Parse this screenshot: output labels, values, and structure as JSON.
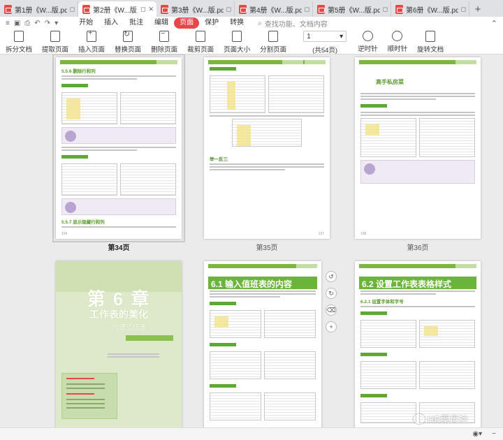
{
  "tabs": [
    {
      "label": "第1册《W...版.pdf",
      "active": false
    },
    {
      "label": "第2册《W...版.pdf",
      "active": true
    },
    {
      "label": "第3册《W...版.pdf",
      "active": false
    },
    {
      "label": "第4册《W...版.pdf",
      "active": false
    },
    {
      "label": "第5册《W...版.pdf",
      "active": false
    },
    {
      "label": "第6册《W...版.pdf",
      "active": false
    }
  ],
  "menu": {
    "items": [
      "开始",
      "插入",
      "批注",
      "编辑",
      "页面",
      "保护",
      "转换"
    ],
    "active": "页面",
    "search_placeholder": "查找功能、文档内容"
  },
  "toolbar": {
    "tools_left": [
      "拆分文档",
      "提取页面",
      "插入页面",
      "替换页面",
      "删除页面",
      "裁剪页面",
      "页面大小",
      "分割页面"
    ],
    "page_input": "1",
    "page_total": "(共54页)",
    "tools_right": [
      "逆时针",
      "顺时针",
      "旋转文档"
    ]
  },
  "pages": {
    "p34": {
      "label": "第34页",
      "section1": "5.5.6 删除行和列",
      "section2": "5.5.7 显示隐藏行和列",
      "note": "工作经验小提示",
      "num": "134"
    },
    "p35": {
      "label": "第35页",
      "section": "举一反三",
      "num": "137"
    },
    "p36": {
      "label": "第36页",
      "title": "高手私房菜",
      "num": "138"
    },
    "p37": {
      "chapter": "第 6 章",
      "title": "工作表的美化",
      "subtitle": "——创建值班表"
    },
    "p38": {
      "title": "6.1 输入值班表的内容"
    },
    "p39": {
      "title": "6.2 设置工作表表格样式",
      "section": "6.2.1 设置字体和字号"
    }
  },
  "watermark": "HR案贝社"
}
